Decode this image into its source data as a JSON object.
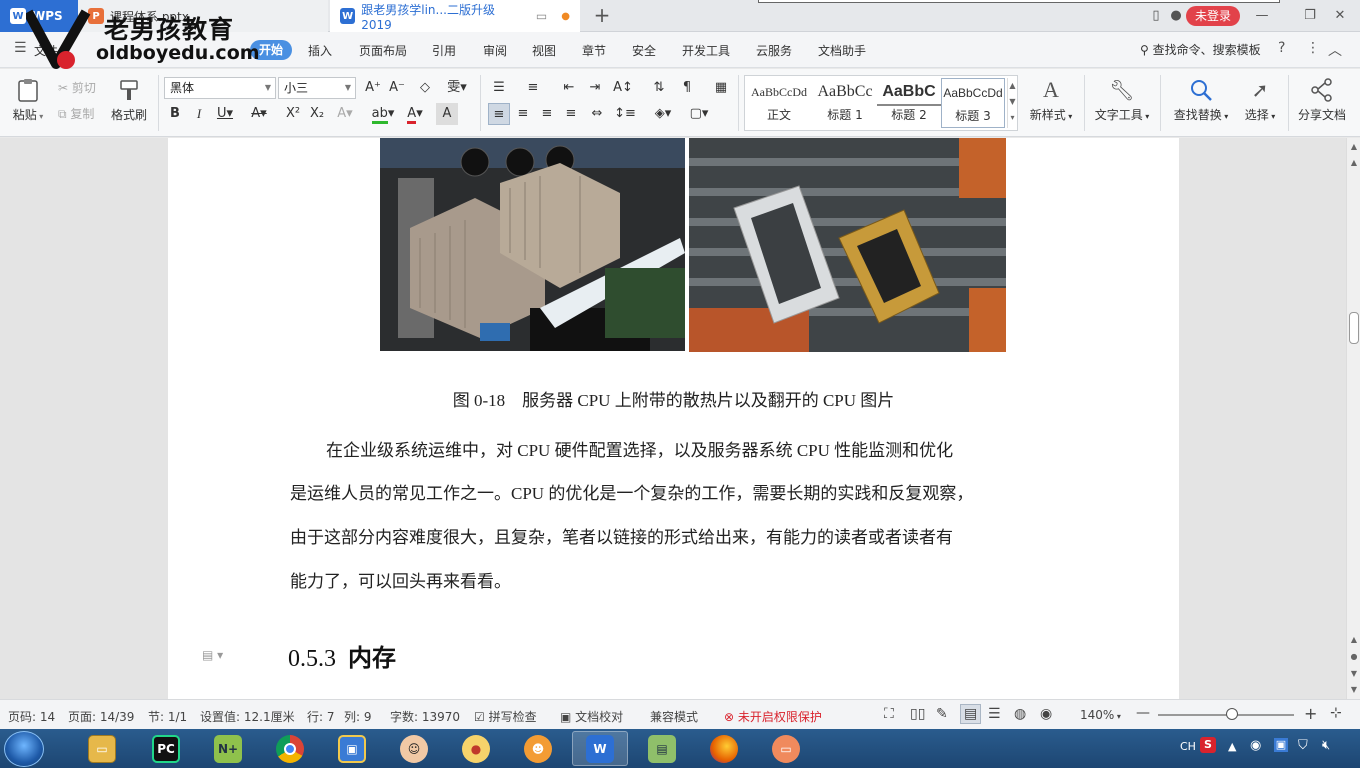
{
  "tabs": [
    {
      "label": "WPS",
      "icon": "wps-logo-icon"
    },
    {
      "label": "课程体系.pptx",
      "icon": "ppt-file-icon"
    },
    {
      "label": "跟老男孩学lin...二版升级2019",
      "icon": "word-file-icon"
    }
  ],
  "titlebar": {
    "login_label": "未登录"
  },
  "watermark": {
    "brand": "老男孩教育",
    "url": "oldboyedu.com"
  },
  "menu": {
    "file_label": "文件",
    "items": [
      "开始",
      "插入",
      "页面布局",
      "引用",
      "审阅",
      "视图",
      "章节",
      "安全",
      "开发工具",
      "云服务",
      "文档助手"
    ],
    "search_label": "查找命令、搜索模板"
  },
  "ribbon": {
    "paste": "粘贴",
    "cut": "剪切",
    "copy": "复制",
    "format_painter": "格式刷",
    "font_name": "黑体",
    "font_size": "小三",
    "styles": [
      {
        "preview": "AaBbCcDd",
        "name": "正文"
      },
      {
        "preview": "AaBbCc",
        "name": "标题 1"
      },
      {
        "preview": "AaBbC",
        "name": "标题 2"
      },
      {
        "preview": "AaBbCcDd",
        "name": "标题 3"
      }
    ],
    "new_style": "新样式",
    "text_tools": "文字工具",
    "find_replace": "查找替换",
    "select": "选择",
    "share_doc": "分享文档"
  },
  "document": {
    "caption": "图 0-18　服务器 CPU 上附带的散热片以及翻开的 CPU 图片",
    "paragraph_lines": [
      "在企业级系统运维中，对 CPU 硬件配置选择，以及服务器系统 CPU 性能监测和优化",
      "是运维人员的常见工作之一。CPU 的优化是一个复杂的工作，需要长期的实践和反复观察，",
      "由于这部分内容难度很大，且复杂，笔者以链接的形式给出来，有能力的读者或者读者有",
      "能力了，可以回头再来看看。"
    ],
    "heading_number": "0.5.3",
    "heading_text": "内存"
  },
  "status": {
    "page_no": "页码: 14",
    "pages": "页面: 14/39",
    "section": "节: 1/1",
    "setting": "设置值: 12.1厘米",
    "row": "行: 7",
    "col": "列: 9",
    "words": "字数: 13970",
    "spell": "拼写检查",
    "proof": "文档校对",
    "compat": "兼容模式",
    "protect": "未开启权限保护",
    "zoom": "140%"
  },
  "tray": {
    "lang": "CH"
  },
  "colors": {
    "accent": "#2d6fd3",
    "danger": "#e2424a",
    "taskbar": "#1d4672"
  }
}
